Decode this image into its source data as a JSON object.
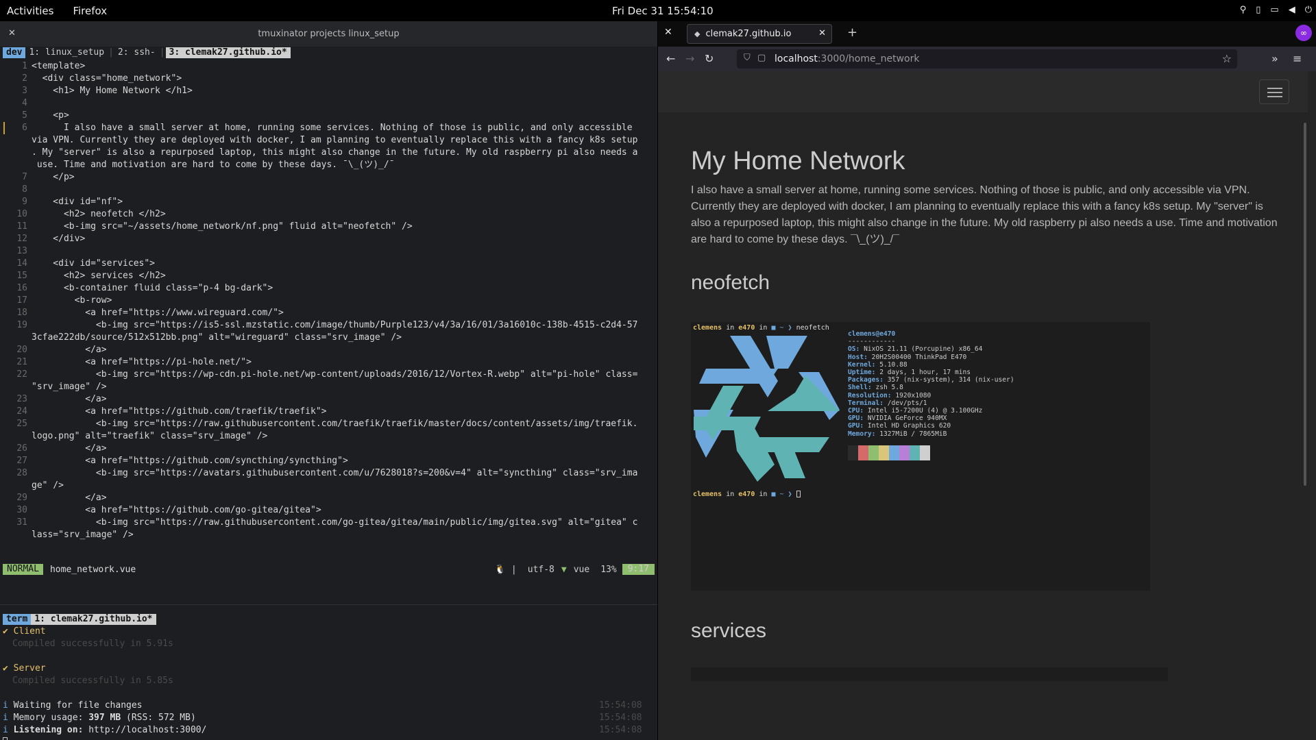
{
  "topbar": {
    "activities": "Activities",
    "app": "Firefox",
    "clock": "Fri Dec 31  15:54:10",
    "tray_icons": [
      "location-icon",
      "battery-icon",
      "display-icon",
      "volume-icon",
      "power-icon"
    ]
  },
  "terminal": {
    "title": "tmuxinator projects linux_setup",
    "session": "dev",
    "windows": [
      "1: linux_setup",
      "2: ssh-",
      "3: clemak27.github.io*"
    ],
    "code_lines": [
      {
        "n": "1",
        "t": "<template>"
      },
      {
        "n": "2",
        "t": "  <div class=\"home_network\">"
      },
      {
        "n": "3",
        "t": "    <h1> My Home Network </h1>"
      },
      {
        "n": "4",
        "t": ""
      },
      {
        "n": "5",
        "t": "    <p>"
      },
      {
        "n": "6",
        "t": "      I also have a small server at home, running some services. Nothing of those is public, and only accessible"
      },
      {
        "n": "",
        "t": "via VPN. Currently they are deployed with docker, I am planning to eventually replace this with a fancy k8s setup"
      },
      {
        "n": "",
        "t": ". My \"server\" is also a repurposed laptop, this might also change in the future. My old raspberry pi also needs a"
      },
      {
        "n": "",
        "t": " use. Time and motivation are hard to come by these days. ¯\\_(ツ)_/¯"
      },
      {
        "n": "7",
        "t": "    </p>"
      },
      {
        "n": "8",
        "t": ""
      },
      {
        "n": "9",
        "t": "    <div id=\"nf\">"
      },
      {
        "n": "10",
        "t": "      <h2> neofetch </h2>"
      },
      {
        "n": "11",
        "t": "      <b-img src=\"~/assets/home_network/nf.png\" fluid alt=\"neofetch\" />"
      },
      {
        "n": "12",
        "t": "    </div>"
      },
      {
        "n": "13",
        "t": ""
      },
      {
        "n": "14",
        "t": "    <div id=\"services\">"
      },
      {
        "n": "15",
        "t": "      <h2> services </h2>"
      },
      {
        "n": "16",
        "t": "      <b-container fluid class=\"p-4 bg-dark\">"
      },
      {
        "n": "17",
        "t": "        <b-row>"
      },
      {
        "n": "18",
        "t": "          <a href=\"https://www.wireguard.com/\">"
      },
      {
        "n": "19",
        "t": "            <b-img src=\"https://is5-ssl.mzstatic.com/image/thumb/Purple123/v4/3a/16/01/3a16010c-138b-4515-c2d4-57"
      },
      {
        "n": "",
        "t": "3cfae222db/source/512x512bb.png\" alt=\"wireguard\" class=\"srv_image\" />"
      },
      {
        "n": "20",
        "t": "          </a>"
      },
      {
        "n": "21",
        "t": "          <a href=\"https://pi-hole.net/\">"
      },
      {
        "n": "22",
        "t": "            <b-img src=\"https://wp-cdn.pi-hole.net/wp-content/uploads/2016/12/Vortex-R.webp\" alt=\"pi-hole\" class="
      },
      {
        "n": "",
        "t": "\"srv_image\" />"
      },
      {
        "n": "23",
        "t": "          </a>"
      },
      {
        "n": "24",
        "t": "          <a href=\"https://github.com/traefik/traefik\">"
      },
      {
        "n": "25",
        "t": "            <b-img src=\"https://raw.githubusercontent.com/traefik/traefik/master/docs/content/assets/img/traefik."
      },
      {
        "n": "",
        "t": "logo.png\" alt=\"traefik\" class=\"srv_image\" />"
      },
      {
        "n": "26",
        "t": "          </a>"
      },
      {
        "n": "27",
        "t": "          <a href=\"https://github.com/syncthing/syncthing\">"
      },
      {
        "n": "28",
        "t": "            <b-img src=\"https://avatars.githubusercontent.com/u/7628018?s=200&v=4\" alt=\"syncthing\" class=\"srv_ima"
      },
      {
        "n": "",
        "t": "ge\" />"
      },
      {
        "n": "29",
        "t": "          </a>"
      },
      {
        "n": "30",
        "t": "          <a href=\"https://github.com/go-gitea/gitea\">"
      },
      {
        "n": "31",
        "t": "            <b-img src=\"https://raw.githubusercontent.com/go-gitea/gitea/main/public/img/gitea.svg\" alt=\"gitea\" c"
      },
      {
        "n": "",
        "t": "lass=\"srv_image\" />"
      }
    ],
    "status": {
      "mode": "NORMAL",
      "file": "home_network.vue",
      "encoding": "utf-8",
      "filetype": "vue",
      "percent": "13%",
      "position": "9:17"
    },
    "lower": {
      "session": "term",
      "window": "1: clemak27.github.io*",
      "client_label": "Client",
      "client_msg": "Compiled successfully in 5.91s",
      "server_label": "Server",
      "server_msg": "Compiled successfully in 5.85s",
      "info1": "Waiting for file changes",
      "info2_label": "Memory usage:",
      "info2_value": "397 MB",
      "info2_rest": "(RSS: 572 MB)",
      "info3_label": "Listening on:",
      "info3_value": "http://localhost:3000/",
      "ts1": "15:54:08",
      "ts2": "15:54:08",
      "ts3": "15:54:08"
    }
  },
  "browser": {
    "tab_title": "clemak27.github.io",
    "url_host": "localhost",
    "url_path": ":3000/home_network",
    "page": {
      "h1": "My Home Network",
      "intro": "I also have a small server at home, running some services. Nothing of those is public, and only accessible via VPN. Currently they are deployed with docker, I am planning to eventually replace this with a fancy k8s setup. My \"server\" is also a repurposed laptop, this might also change in the future. My old raspberry pi also needs a use. Time and motivation are hard to come by these days. ¯\\_(ツ)_/¯",
      "h2_nf": "neofetch",
      "h2_services": "services"
    },
    "neofetch": {
      "prompt_user": "clemens",
      "prompt_in": "in",
      "prompt_host": "e470",
      "prompt_cmd": "neofetch",
      "title": "clemens@e470",
      "rule": "------------",
      "info": [
        {
          "k": "OS:",
          "v": "NixOS 21.11 (Porcupine) x86_64"
        },
        {
          "k": "Host:",
          "v": "20H2S00400 ThinkPad E470"
        },
        {
          "k": "Kernel:",
          "v": "5.10.88"
        },
        {
          "k": "Uptime:",
          "v": "2 days, 1 hour, 17 mins"
        },
        {
          "k": "Packages:",
          "v": "357 (nix-system), 314 (nix-user)"
        },
        {
          "k": "Shell:",
          "v": "zsh 5.8"
        },
        {
          "k": "Resolution:",
          "v": "1920x1080"
        },
        {
          "k": "Terminal:",
          "v": "/dev/pts/1"
        },
        {
          "k": "CPU:",
          "v": "Intel i5-7200U (4) @ 3.100GHz"
        },
        {
          "k": "GPU:",
          "v": "NVIDIA GeForce 940MX"
        },
        {
          "k": "GPU:",
          "v": "Intel HD Graphics 620"
        },
        {
          "k": "Memory:",
          "v": "1327MiB / 7865MiB"
        }
      ],
      "colors": [
        "#2b2b2b",
        "#d46a6a",
        "#8fbe6e",
        "#d8c77a",
        "#6fa8dc",
        "#b87fd6",
        "#5fb3b3",
        "#cfcfcf"
      ]
    }
  }
}
